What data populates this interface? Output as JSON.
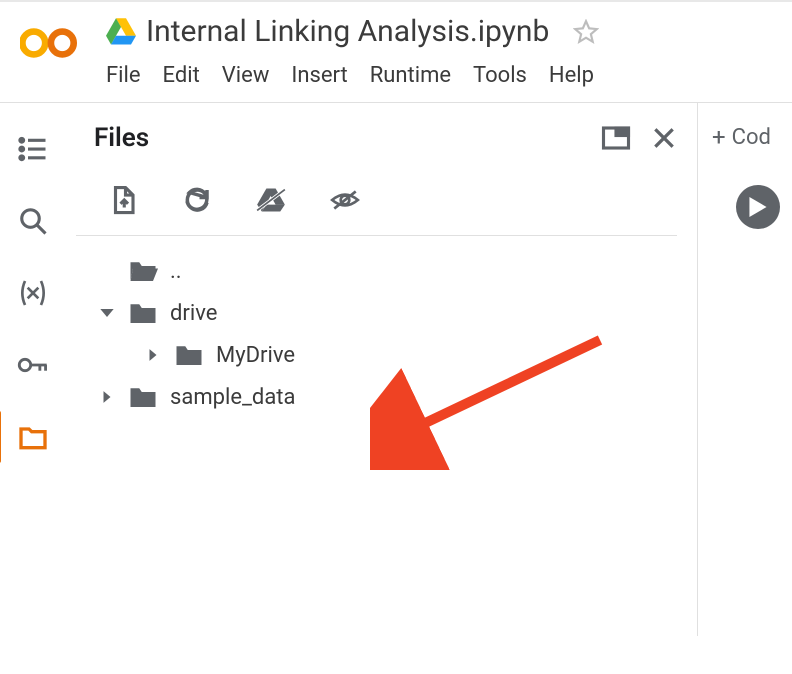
{
  "header": {
    "title": "Internal Linking Analysis.ipynb",
    "menu": [
      "File",
      "Edit",
      "View",
      "Insert",
      "Runtime",
      "Tools",
      "Help"
    ]
  },
  "panel": {
    "title": "Files"
  },
  "tree": {
    "parent": "..",
    "drive": "drive",
    "mydrive": "MyDrive",
    "sample": "sample_data"
  },
  "actions": {
    "add_code": "Cod"
  }
}
